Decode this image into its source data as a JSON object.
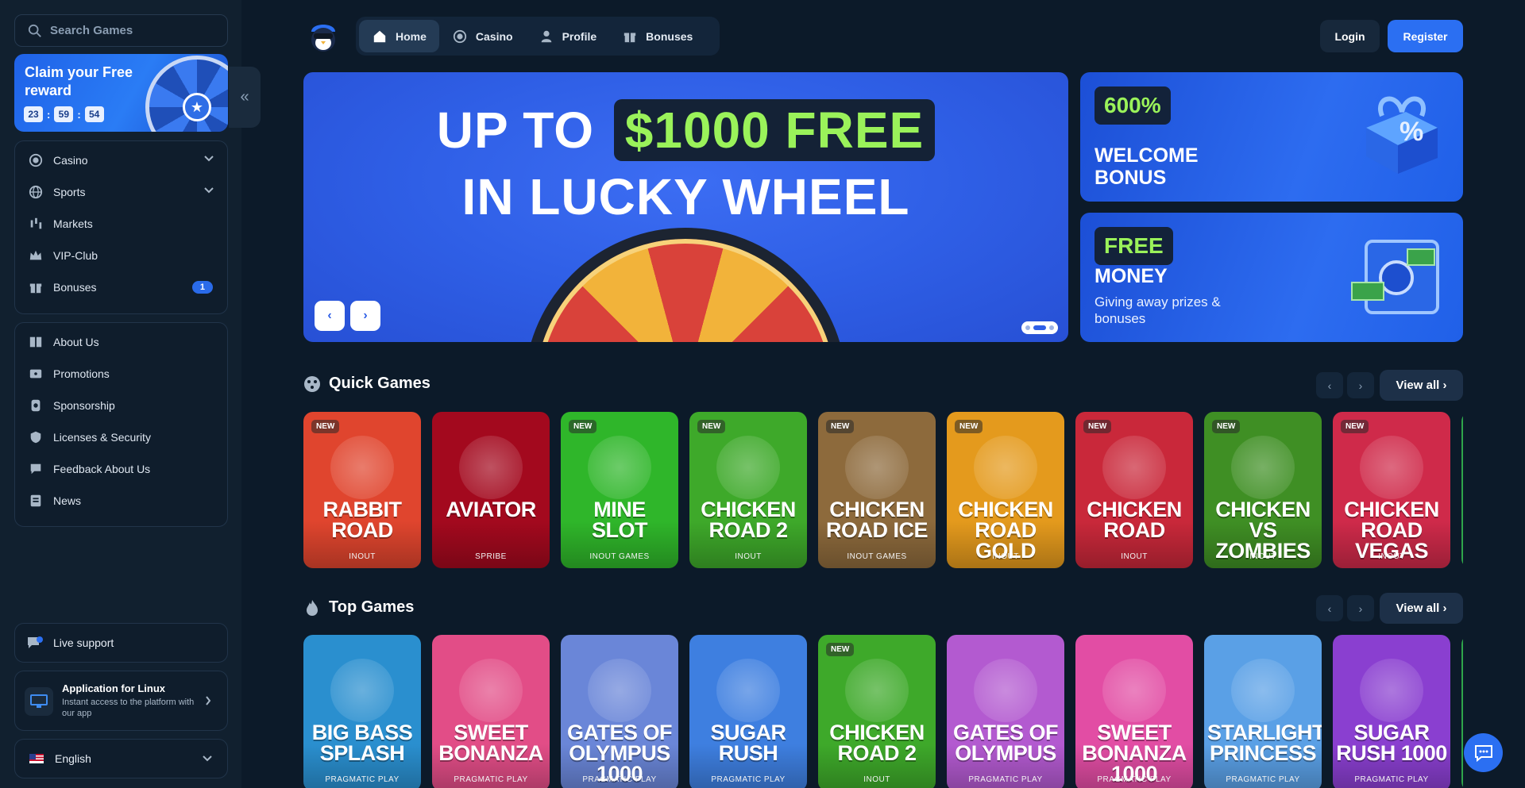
{
  "search": {
    "placeholder": "Search Games"
  },
  "reward": {
    "title": "Claim your Free reward",
    "hours": "23",
    "minutes": "59",
    "seconds": "54"
  },
  "sidebar": {
    "main_items": [
      {
        "label": "Casino",
        "icon": "casino-chip-icon",
        "has_chevron": true
      },
      {
        "label": "Sports",
        "icon": "globe-icon",
        "has_chevron": true
      },
      {
        "label": "Markets",
        "icon": "candlestick-icon"
      },
      {
        "label": "VIP-Club",
        "icon": "crown-icon"
      },
      {
        "label": "Bonuses",
        "icon": "gift-icon",
        "badge": "1"
      }
    ],
    "info_items": [
      {
        "label": "About Us",
        "icon": "book-icon"
      },
      {
        "label": "Promotions",
        "icon": "ticket-icon"
      },
      {
        "label": "Sponsorship",
        "icon": "badge-icon"
      },
      {
        "label": "Licenses & Security",
        "icon": "shield-icon"
      },
      {
        "label": "Feedback About Us",
        "icon": "feedback-icon"
      },
      {
        "label": "News",
        "icon": "newspaper-icon"
      }
    ],
    "support_label": "Live support",
    "app": {
      "title": "Application for Linux",
      "subtitle": "Instant access to the platform with our app"
    },
    "language": "English"
  },
  "topnav": {
    "items": [
      {
        "label": "Home",
        "icon": "home-icon",
        "active": true
      },
      {
        "label": "Casino",
        "icon": "casino-chip-icon"
      },
      {
        "label": "Profile",
        "icon": "user-icon"
      },
      {
        "label": "Bonuses",
        "icon": "gift-icon"
      }
    ],
    "login": "Login",
    "register": "Register"
  },
  "hero": {
    "line1_prefix": "UP TO",
    "line1_highlight": "$1000 FREE",
    "line2": "IN LUCKY WHEEL",
    "prev": "‹",
    "next": "›"
  },
  "promos": [
    {
      "tag": "600%",
      "title_l1": "WELCOME",
      "title_l2": "BONUS"
    },
    {
      "tag": "FREE",
      "title_l1": "MONEY",
      "subtitle": "Giving away prizes & bonuses"
    }
  ],
  "quick_games": {
    "title": "Quick Games",
    "view_all": "View all",
    "games": [
      {
        "title": "RABBIT ROAD",
        "provider": "INOUT",
        "new": true,
        "bg": "#e0452e"
      },
      {
        "title": "AVIATOR",
        "provider": "SPRIBE",
        "new": false,
        "bg": "#a3091e"
      },
      {
        "title": "MINE SLOT",
        "provider": "INOUT GAMES",
        "new": true,
        "bg": "#2fb62a"
      },
      {
        "title": "CHICKEN ROAD 2",
        "provider": "INOUT",
        "new": true,
        "bg": "#3ea92a"
      },
      {
        "title": "CHICKEN ROAD ICE",
        "provider": "INOUT GAMES",
        "new": true,
        "bg": "#8d6a3c"
      },
      {
        "title": "CHICKEN ROAD GOLD",
        "provider": "INOUT",
        "new": true,
        "bg": "#e49a1d"
      },
      {
        "title": "CHICKEN ROAD",
        "provider": "INOUT",
        "new": true,
        "bg": "#c9283a"
      },
      {
        "title": "CHICKEN VS ZOMBIES",
        "provider": "INOUT",
        "new": true,
        "bg": "#3f8f24"
      },
      {
        "title": "CHICKEN ROAD VEGAS",
        "provider": "INOUT",
        "new": true,
        "bg": "#cf2a4a"
      }
    ]
  },
  "top_games": {
    "title": "Top Games",
    "view_all": "View all",
    "games": [
      {
        "title": "BIG BASS SPLASH",
        "provider": "PRAGMATIC PLAY",
        "new": false,
        "bg": "#2a8fcf"
      },
      {
        "title": "SWEET BONANZA",
        "provider": "PRAGMATIC PLAY",
        "new": false,
        "bg": "#e24d87"
      },
      {
        "title": "GATES OF OLYMPUS 1000",
        "provider": "PRAGMATIC PLAY",
        "new": false,
        "bg": "#6a86d8"
      },
      {
        "title": "SUGAR RUSH",
        "provider": "PRAGMATIC PLAY",
        "new": false,
        "bg": "#3e7fe0"
      },
      {
        "title": "CHICKEN ROAD 2",
        "provider": "INOUT",
        "new": true,
        "bg": "#3ea92a"
      },
      {
        "title": "GATES OF OLYMPUS",
        "provider": "PRAGMATIC PLAY",
        "new": false,
        "bg": "#b35ad0"
      },
      {
        "title": "SWEET BONANZA 1000",
        "provider": "PRAGMATIC PLAY",
        "new": false,
        "bg": "#e24da4"
      },
      {
        "title": "STARLIGHT PRINCESS",
        "provider": "PRAGMATIC PLAY",
        "new": false,
        "bg": "#5aa0e6"
      },
      {
        "title": "SUGAR RUSH 1000",
        "provider": "PRAGMATIC PLAY",
        "new": false,
        "bg": "#8a3fd0"
      }
    ]
  },
  "colors": {
    "accent": "#2b6ff2",
    "highlight_green": "#9af25a",
    "background": "#0c1a29",
    "sidebar": "#11202f"
  }
}
